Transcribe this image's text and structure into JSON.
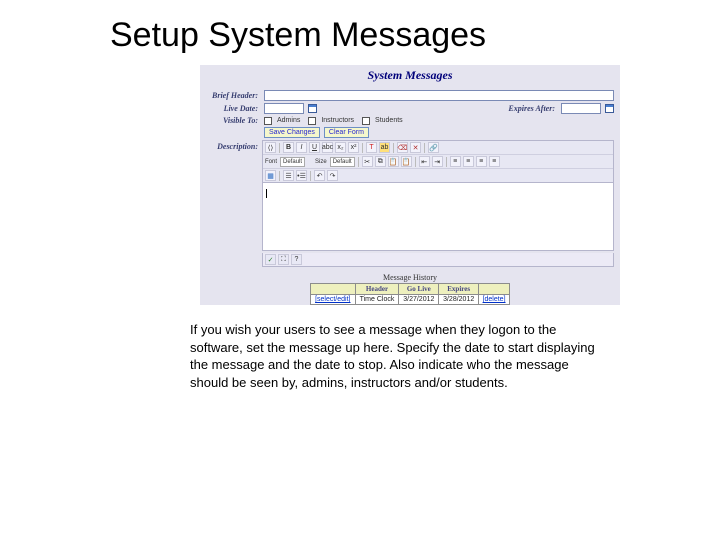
{
  "slide": {
    "title": "Setup System Messages",
    "caption": "If you wish your users to see a message when they logon to the software, set the message up here. Specify the date to start displaying the message and the date to stop. Also indicate who the message should be seen by, admins, instructors and/or students."
  },
  "panel": {
    "title": "System Messages",
    "labels": {
      "brief_header": "Brief Header:",
      "live_date": "Live Date:",
      "expires_after": "Expires After:",
      "visible_to": "Visible To:",
      "description": "Description:"
    },
    "visible_to": {
      "admins": "Admins",
      "instructors": "Instructors",
      "students": "Students"
    },
    "buttons": {
      "save": "Save Changes",
      "clear": "Clear Form"
    },
    "editor": {
      "font_label": "Font",
      "font_value": "Default",
      "size_label": "Size",
      "size_value": "Default"
    },
    "history": {
      "title": "Message History",
      "headers": [
        "",
        "Header",
        "Go Live",
        "Expires",
        ""
      ],
      "rows": [
        {
          "select": "[select/edit]",
          "header": "Time Clock",
          "golive": "3/27/2012",
          "expires": "3/28/2012",
          "delete": "[delete]"
        }
      ]
    }
  }
}
